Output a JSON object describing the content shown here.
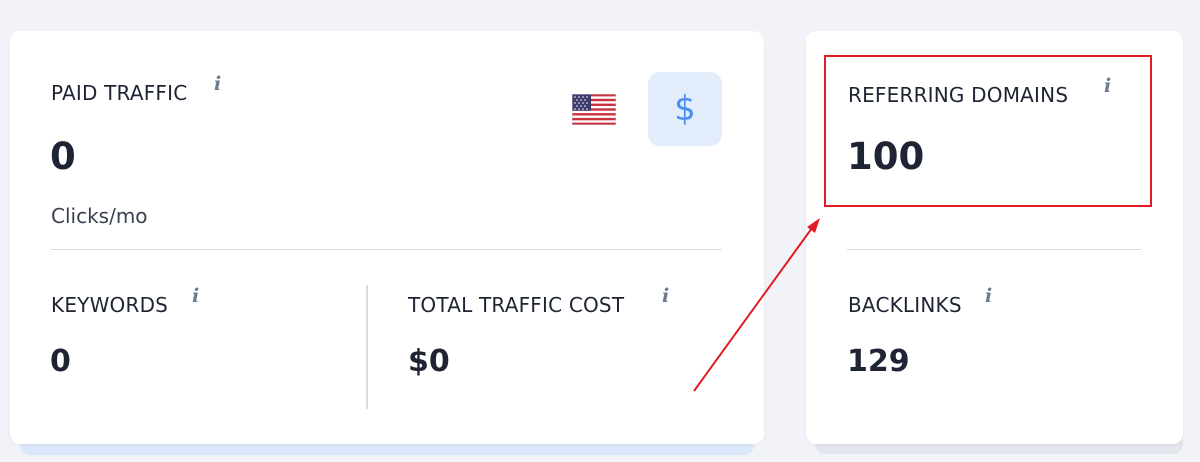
{
  "paid_traffic": {
    "label": "PAID TRAFFIC",
    "info": "i",
    "value": "0",
    "unit": "Clicks/mo",
    "currency_button": "$",
    "flag_icon": "us-flag-icon"
  },
  "keywords": {
    "label": "KEYWORDS",
    "info": "i",
    "value": "0"
  },
  "total_traffic_cost": {
    "label": "TOTAL TRAFFIC COST",
    "info": "i",
    "value": "$0"
  },
  "referring_domains": {
    "label": "REFERRING DOMAINS",
    "info": "i",
    "value": "100"
  },
  "backlinks": {
    "label": "BACKLINKS",
    "info": "i",
    "value": "129"
  },
  "colors": {
    "background": "#f2f3f8",
    "card": "#ffffff",
    "accent": "#4a8ef0",
    "annotation": "#e01b24"
  }
}
